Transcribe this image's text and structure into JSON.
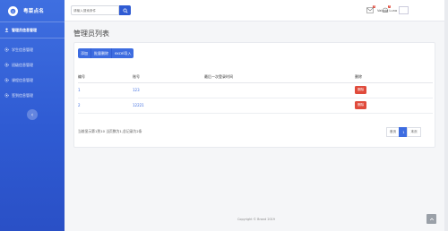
{
  "brand": {
    "name": "粤菜点名"
  },
  "sidebar": {
    "items": [
      {
        "label": "管理员信息管理",
        "active": true,
        "icon": "user-icon"
      },
      {
        "label": "学生信息管理",
        "active": false,
        "icon": "gear-icon"
      },
      {
        "label": "班级信息管理",
        "active": false,
        "icon": "gear-icon"
      },
      {
        "label": "课程信息管理",
        "active": false,
        "icon": "gear-icon"
      },
      {
        "label": "签到信息管理",
        "active": false,
        "icon": "gear-icon"
      }
    ],
    "collapse_icon": "chevron-left-icon"
  },
  "topbar": {
    "search_placeholder": "请输入搜索条件",
    "notifications": {
      "mail_count": "8",
      "bell_count": "3"
    },
    "user_name": "Valerie Luna"
  },
  "page": {
    "title": "管理员列表"
  },
  "toolbar": {
    "add": "添加",
    "batch_delete": "批量删除",
    "excel_import": "excel导入"
  },
  "table": {
    "headers": [
      "编号",
      "账号",
      "最后一次登录时间",
      "删除"
    ],
    "rows": [
      {
        "id": "1",
        "account": "123",
        "last_login": "",
        "action": "删除"
      },
      {
        "id": "2",
        "account": "12221",
        "last_login": "",
        "action": "删除"
      }
    ]
  },
  "pagination": {
    "info": "当前显示第1到10 当页数为1,总记录为2条",
    "first": "首页",
    "current": "1",
    "last": "末页"
  },
  "footer": {
    "copyright": "Copyright © Brand 2019"
  },
  "colors": {
    "primary": "#2f5bd3",
    "danger": "#e04b3c"
  }
}
